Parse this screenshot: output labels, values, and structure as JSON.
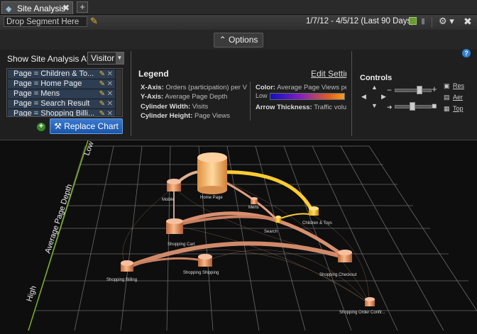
{
  "tab": {
    "title": "Site Analysis",
    "close": "✖",
    "add": "+"
  },
  "toolbar": {
    "segment_placeholder": "Drop Segment Here",
    "date_range": "1/7/12 - 4/5/12 (Last 90 Days)",
    "wrench_label": "⚙ ▾",
    "close_label": "✖"
  },
  "options": {
    "label": "⌃ Options"
  },
  "show_at": {
    "label": "Show Site Analysis At:",
    "value": "Visitor"
  },
  "pages": [
    "Page = Children & To...",
    "Page = Home Page",
    "Page = Mens",
    "Page = Search Result",
    "Page = Shopping Billi..."
  ],
  "replace_chart": "Replace Chart",
  "legend": {
    "title": "Legend",
    "edit": "Edit Settings",
    "rows": [
      {
        "key": "X-Axis:",
        "value": "Orders (participation) per Visit"
      },
      {
        "key": "Y-Axis:",
        "value": "Average Page Depth"
      },
      {
        "key": "Cylinder Width:",
        "value": "Visits"
      },
      {
        "key": "Cylinder Height:",
        "value": "Page Views"
      },
      {
        "key": "Color:",
        "value": "Average Page Views per"
      },
      {
        "key": "Arrow Thickness:",
        "value": "Traffic volu"
      }
    ],
    "low": "Low"
  },
  "controls": {
    "title": "Controls",
    "minus": "−",
    "plus": "+",
    "links": [
      "Res",
      "Aer",
      "Top"
    ]
  },
  "viz": {
    "axis_y": "Average Page Depth",
    "axis_low": "Low",
    "axis_high": "High",
    "nodes": [
      {
        "label": "Home Page"
      },
      {
        "label": "Mobile"
      },
      {
        "label": "Mens"
      },
      {
        "label": "Children & Toys"
      },
      {
        "label": "Search"
      },
      {
        "label": "Shopping Cart"
      },
      {
        "label": "Shopping Shipping"
      },
      {
        "label": "Shopping Billing"
      },
      {
        "label": "Shopping Checkout"
      },
      {
        "label": "Shopping Order Confir..."
      }
    ]
  },
  "colors": {
    "accent": "#2f6fc4",
    "node": "#f0a060",
    "arrow": "#f0c070",
    "highlight": "#ffcc33"
  }
}
